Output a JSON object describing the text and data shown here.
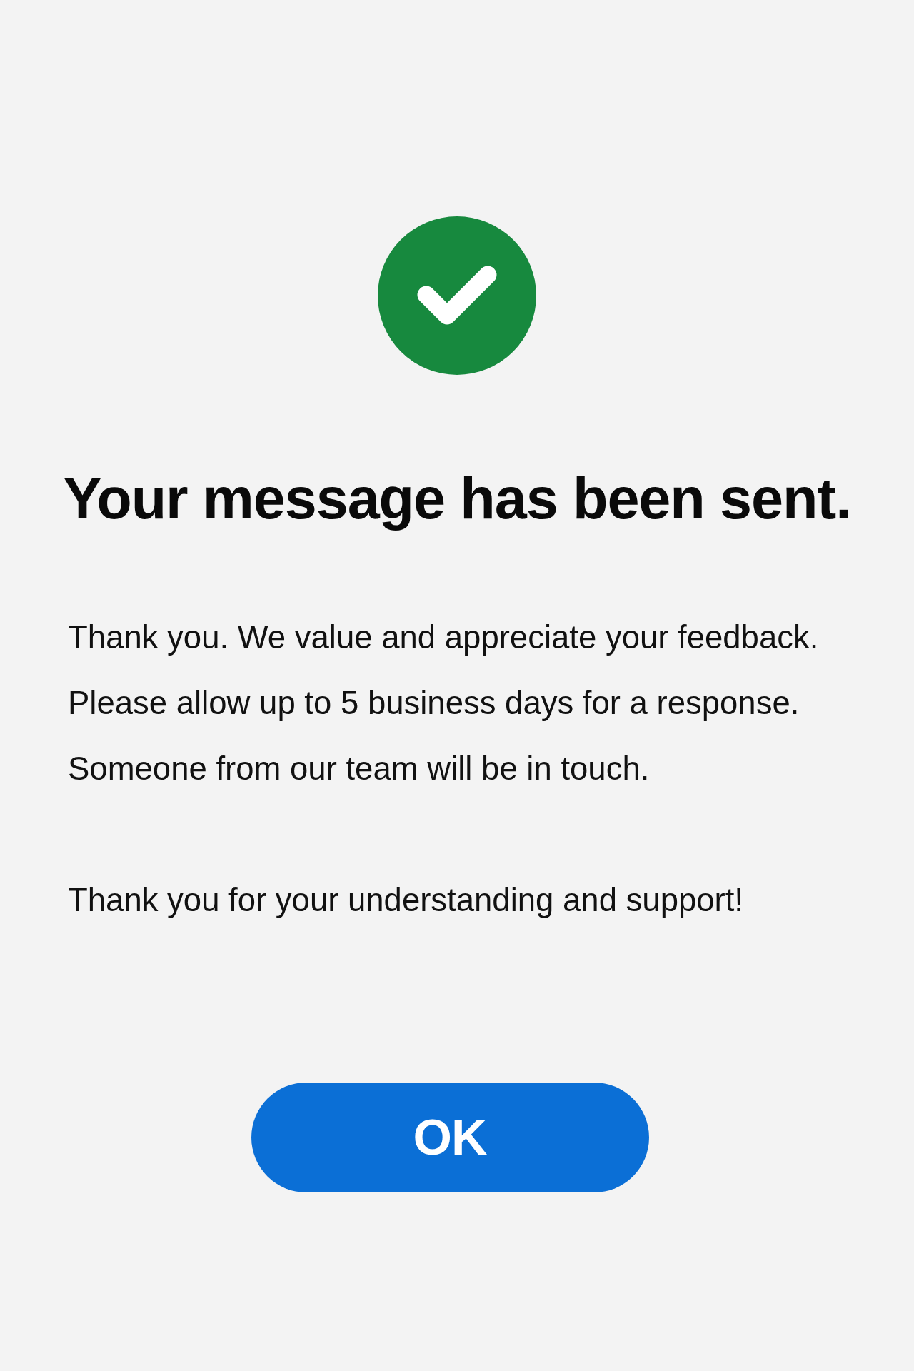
{
  "title": "Your message has been sent.",
  "message": {
    "lines": [
      "Thank you. We value and appreciate your feedback.",
      "Please allow up to 5 business days for a response.",
      "Someone from our team will be in touch."
    ],
    "closing": "Thank you for your understanding and support!"
  },
  "button": {
    "label": "OK"
  }
}
